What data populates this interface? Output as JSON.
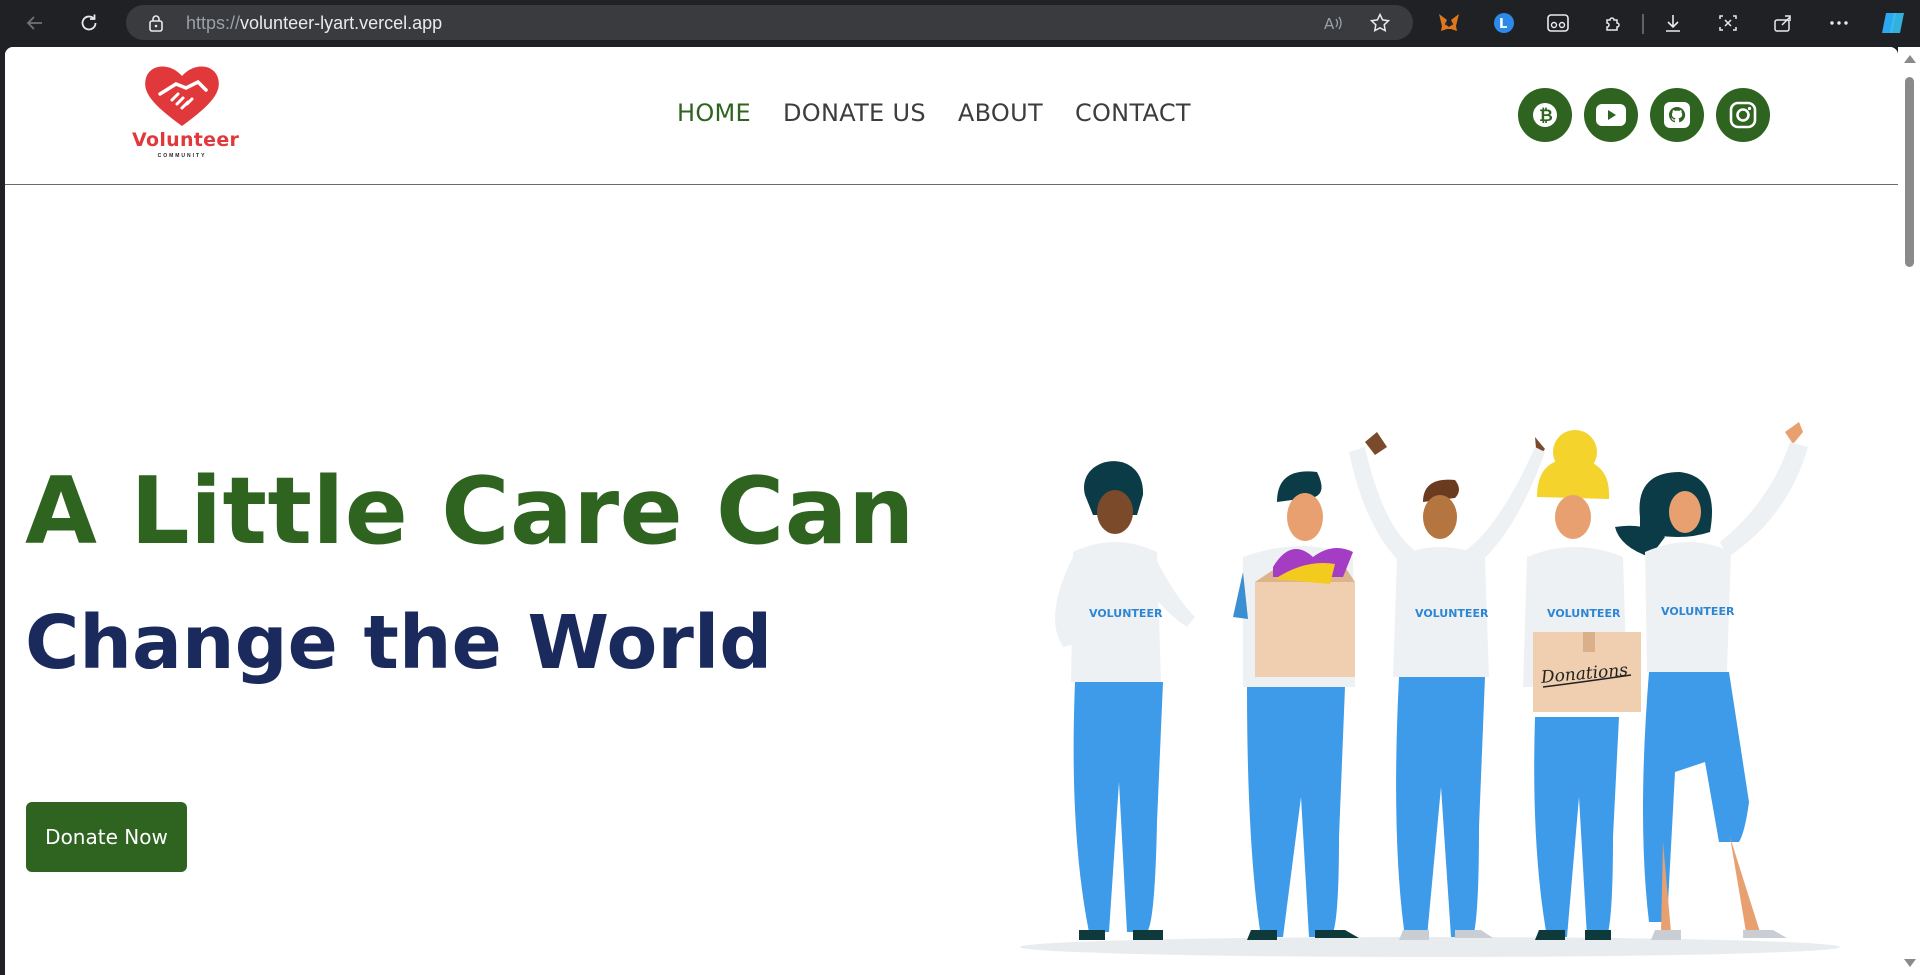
{
  "browser": {
    "url_protocol": "https://",
    "url_host": "volunteer-lyart.vercel.app"
  },
  "site": {
    "logo": {
      "name": "Volunteer",
      "subtitle": "COMMUNITY"
    },
    "nav": [
      {
        "label": "HOME",
        "active": true
      },
      {
        "label": "DONATE US",
        "active": false
      },
      {
        "label": "ABOUT",
        "active": false
      },
      {
        "label": "CONTACT",
        "active": false
      }
    ],
    "socials": [
      "bitcoin-icon",
      "youtube-icon",
      "github-icon",
      "instagram-icon"
    ],
    "colors": {
      "primary_green": "#2e6320",
      "navy": "#1a2a5c",
      "logo_red": "#e0383b"
    }
  },
  "hero": {
    "title_line1": "A Little Care Can",
    "title_line2": "Change the World",
    "cta_label": "Donate Now",
    "illustration": {
      "shirt_text": "VOLUNTEER",
      "box_text": "Donations"
    }
  }
}
